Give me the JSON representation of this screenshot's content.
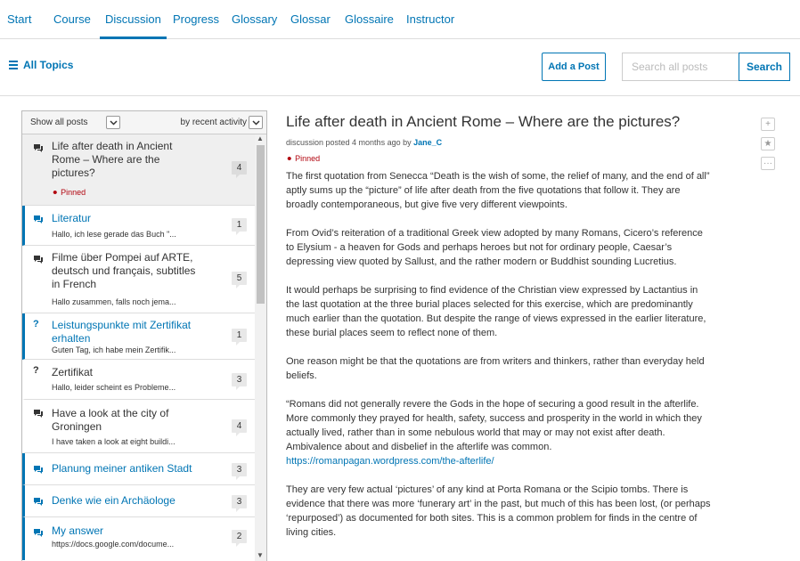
{
  "nav": {
    "tabs": [
      {
        "label": "Start",
        "active": false
      },
      {
        "label": "Course",
        "active": false
      },
      {
        "label": "Discussion",
        "active": true
      },
      {
        "label": "Progress",
        "active": false
      },
      {
        "label": "Glossary",
        "active": false
      },
      {
        "label": "Glossar",
        "active": false
      },
      {
        "label": "Glossaire",
        "active": false
      },
      {
        "label": "Instructor",
        "active": false
      }
    ]
  },
  "header": {
    "all_topics": "All Topics",
    "add_post": "Add a Post",
    "search_placeholder": "Search all posts",
    "search_button": "Search"
  },
  "sidebar": {
    "filter_label": "Show all posts",
    "sort_label": "by recent activity",
    "posts": [
      {
        "title": "Life after death in Ancient Rome – Where are the pictures?",
        "preview": "",
        "count": "4",
        "pinned": "Pinned",
        "type": "discussion",
        "unread": false,
        "selected": true
      },
      {
        "title": "Literatur",
        "preview": "Hallo, ich lese gerade das Buch \"...",
        "count": "1",
        "type": "discussion",
        "unread": true
      },
      {
        "title": "Filme über Pompei auf ARTE, deutsch und français, subtitles in French",
        "preview": "Hallo zusammen, falls noch jema...",
        "count": "5",
        "type": "discussion",
        "unread": false
      },
      {
        "title": "Leistungspunkte mit Zertifikat erhalten",
        "preview": "Guten Tag, ich habe mein Zertifik...",
        "count": "1",
        "type": "question",
        "unread": true
      },
      {
        "title": "Zertifikat",
        "preview": "Hallo, leider scheint es Probleme...",
        "count": "3",
        "type": "question",
        "unread": false
      },
      {
        "title": "Have a look at the city of Groningen",
        "preview": "I have taken a look at eight buildi...",
        "count": "4",
        "type": "discussion",
        "unread": false
      },
      {
        "title": "Planung meiner antiken Stadt",
        "preview": "",
        "count": "3",
        "type": "discussion",
        "unread": true
      },
      {
        "title": "Denke wie ein Archäologe",
        "preview": "",
        "count": "3",
        "type": "discussion",
        "unread": true
      },
      {
        "title": "My answer",
        "preview": "https://docs.google.com/docume...",
        "count": "2",
        "type": "discussion",
        "unread": true
      }
    ]
  },
  "thread": {
    "title": "Life after death in Ancient Rome – Where are the pictures?",
    "meta_prefix": "discussion posted 4 months ago by",
    "author": "Jane_C",
    "pinned": "Pinned",
    "paragraphs": [
      "The first quotation from Senecca “Death is the wish of some, the relief of many, and the end of all” aptly sums up the “picture” of life after death from the five quotations that follow it. They are broadly contemporaneous, but give five very different viewpoints.",
      "From Ovid’s reiteration of a traditional Greek view adopted by many Romans, Cicero’s reference to Elysium - a heaven for Gods and perhaps heroes but not for ordinary people, Caesar’s depressing view quoted by Sallust, and the rather modern or Buddhist sounding Lucretius.",
      "It would perhaps be surprising to find evidence of the Christian view expressed by Lactantius in the last quotation at the three burial places selected for this exercise, which are predominantly much earlier than the quotation. But despite the range of views expressed in the earlier literature, these burial places seem to reflect none of them.",
      "One reason might be that the quotations are from writers and thinkers, rather than everyday held beliefs.",
      "“Romans did not generally revere the Gods in the hope of securing a good result in the afterlife. More commonly they prayed for health, safety, success and prosperity in the world in which they actually lived, rather than in some nebulous world that may or may not exist after death. Ambivalence about and disbelief in the afterlife was common.",
      "They are very few actual ‘pictures’ of any kind at Porta Romana or the Scipio tombs. There is evidence that there was more ‘funerary art’ in the past, but much of this has been lost, (or perhaps ‘repurposed’) as documented for both sites. This is a common problem for finds in the centre of living cities."
    ],
    "link": "https://romanpagan.wordpress.com/the-afterlife/"
  },
  "colors": {
    "accent": "#0075b4",
    "pinned": "#b20610"
  }
}
